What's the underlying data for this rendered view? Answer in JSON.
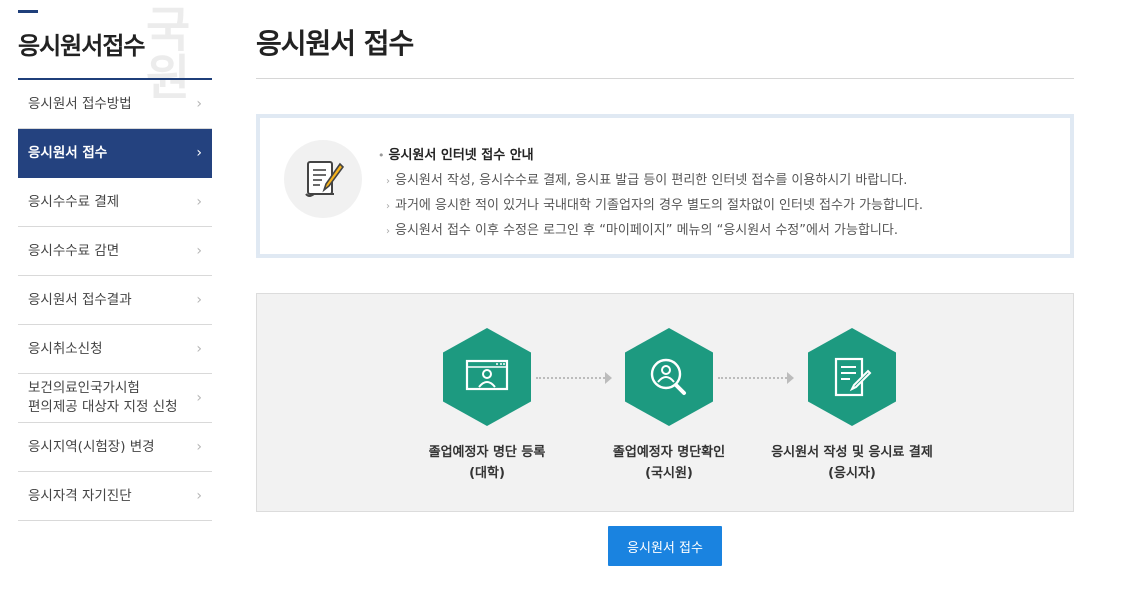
{
  "sidebar": {
    "title": "응시원서접수",
    "watermark": "국원",
    "items": [
      {
        "label": "응시원서 접수방법",
        "active": false
      },
      {
        "label": "응시원서 접수",
        "active": true
      },
      {
        "label": "응시수수료 결제",
        "active": false
      },
      {
        "label": "응시수수료 감면",
        "active": false
      },
      {
        "label": "응시원서 접수결과",
        "active": false
      },
      {
        "label": "응시취소신청",
        "active": false
      },
      {
        "label": "보건의료인국가시험\n편의제공 대상자 지정 신청",
        "active": false
      },
      {
        "label": "응시지역(시험장) 변경",
        "active": false
      },
      {
        "label": "응시자격 자기진단",
        "active": false
      }
    ],
    "chevron": "›"
  },
  "main": {
    "title": "응시원서 접수",
    "notice": {
      "icon": "document-pen-icon",
      "heading": "응시원서 인터넷 접수 안내",
      "lines": [
        "응시원서 작성, 응시수수료 결제, 응시표 발급 등이 편리한 인터넷 접수를 이용하시기 바랍니다.",
        "과거에 응시한 적이 있거나 국내대학 기졸업자의 경우 별도의 절차없이 인터넷 접수가 가능합니다.",
        "응시원서 접수 이후 수정은 로그인 후 “마이페이지” 메뉴의 “응시원서 수정”에서 가능합니다."
      ]
    },
    "process": {
      "steps": [
        {
          "icon": "monitor-person-icon",
          "title": "졸업예정자 명단 등록",
          "sub": "(대학)"
        },
        {
          "icon": "person-search-icon",
          "title": "졸업예정자 명단확인",
          "sub": "(국시원)"
        },
        {
          "icon": "form-write-icon",
          "title": "응시원서 작성 및 응시료 결제",
          "sub": "(응시자)"
        }
      ]
    },
    "apply_button": "응시원서 접수"
  },
  "colors": {
    "navy": "#24427f",
    "teal": "#1d9a80",
    "button_blue": "#1a83e0",
    "notice_border": "#e0e9f3"
  }
}
